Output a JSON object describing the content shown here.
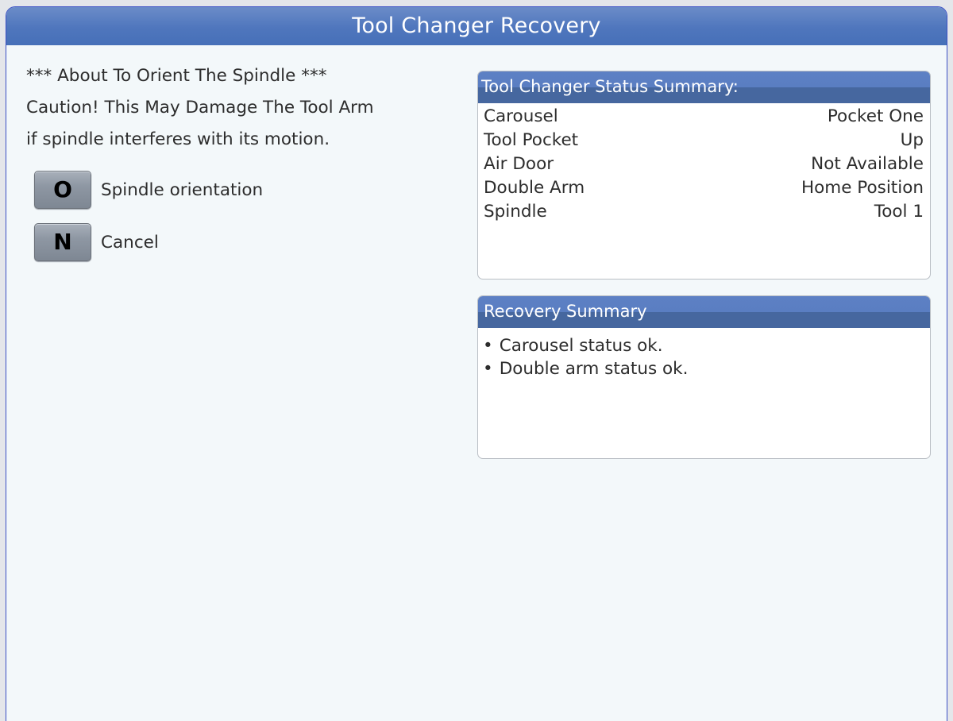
{
  "window": {
    "title": "Tool Changer Recovery"
  },
  "message": {
    "lines": [
      "*** About To Orient The Spindle ***",
      "Caution! This May Damage The Tool Arm",
      "if spindle interferes with its motion."
    ]
  },
  "options": [
    {
      "key": "O",
      "label": "Spindle orientation"
    },
    {
      "key": "N",
      "label": "Cancel"
    }
  ],
  "status_summary": {
    "title": "Tool Changer Status Summary:",
    "rows": [
      {
        "label": "Carousel",
        "value": "Pocket One"
      },
      {
        "label": "Tool Pocket",
        "value": "Up"
      },
      {
        "label": "Air Door",
        "value": "Not Available"
      },
      {
        "label": "Double Arm",
        "value": "Home Position"
      },
      {
        "label": "Spindle",
        "value": "Tool 1"
      }
    ]
  },
  "recovery_summary": {
    "title": "Recovery Summary",
    "bullet": "•",
    "items": [
      "Carousel status ok.",
      "Double arm status ok."
    ]
  },
  "colors": {
    "titlebar": "#4f76bd",
    "panel_header": "#5a7ec2",
    "background": "#f3f8fa",
    "key_button": "#8e97a3"
  }
}
